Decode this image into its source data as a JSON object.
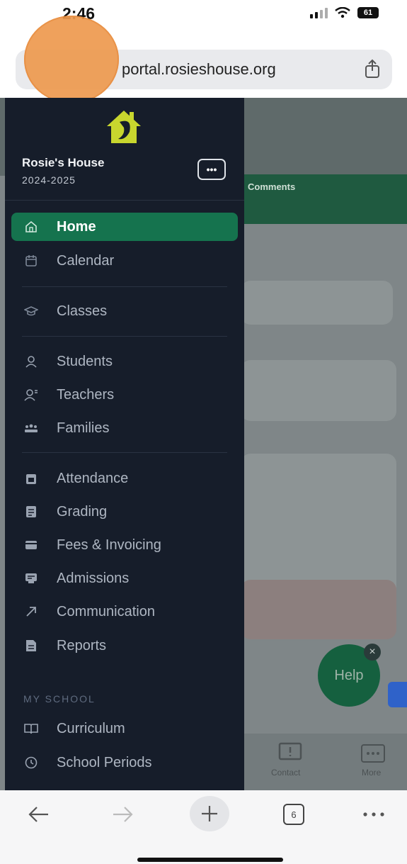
{
  "status": {
    "time": "2:46",
    "battery": "61"
  },
  "browser": {
    "url": "portal.rosieshouse.org",
    "tab_count": "6"
  },
  "sidebar": {
    "school_name": "Rosie's House",
    "school_year": "2024-2025",
    "more_label": "•••",
    "nav_items": [
      {
        "label": "Home",
        "icon": "home-icon",
        "active": true
      },
      {
        "label": "Calendar",
        "icon": "calendar-icon"
      },
      {
        "label": "Classes",
        "icon": "graduation-cap-icon"
      },
      {
        "label": "Students",
        "icon": "student-icon"
      },
      {
        "label": "Teachers",
        "icon": "teacher-icon"
      },
      {
        "label": "Families",
        "icon": "families-icon"
      },
      {
        "label": "Attendance",
        "icon": "attendance-icon"
      },
      {
        "label": "Grading",
        "icon": "grading-icon"
      },
      {
        "label": "Fees & Invoicing",
        "icon": "invoice-icon"
      },
      {
        "label": "Admissions",
        "icon": "admissions-icon"
      },
      {
        "label": "Communication",
        "icon": "arrow-icon"
      },
      {
        "label": "Reports",
        "icon": "report-icon"
      },
      {
        "label": "Curriculum",
        "icon": "book-icon"
      },
      {
        "label": "School Periods",
        "icon": "clock-icon"
      }
    ],
    "section_my_school": "MY SCHOOL"
  },
  "background": {
    "strip_title": "Comments",
    "help_label": "Help",
    "bottom_labels": [
      "Contact",
      "More"
    ]
  },
  "colors": {
    "sidebar_bg": "#161d2a",
    "active_item": "#15734e",
    "accent_logo": "#c8d62e"
  }
}
